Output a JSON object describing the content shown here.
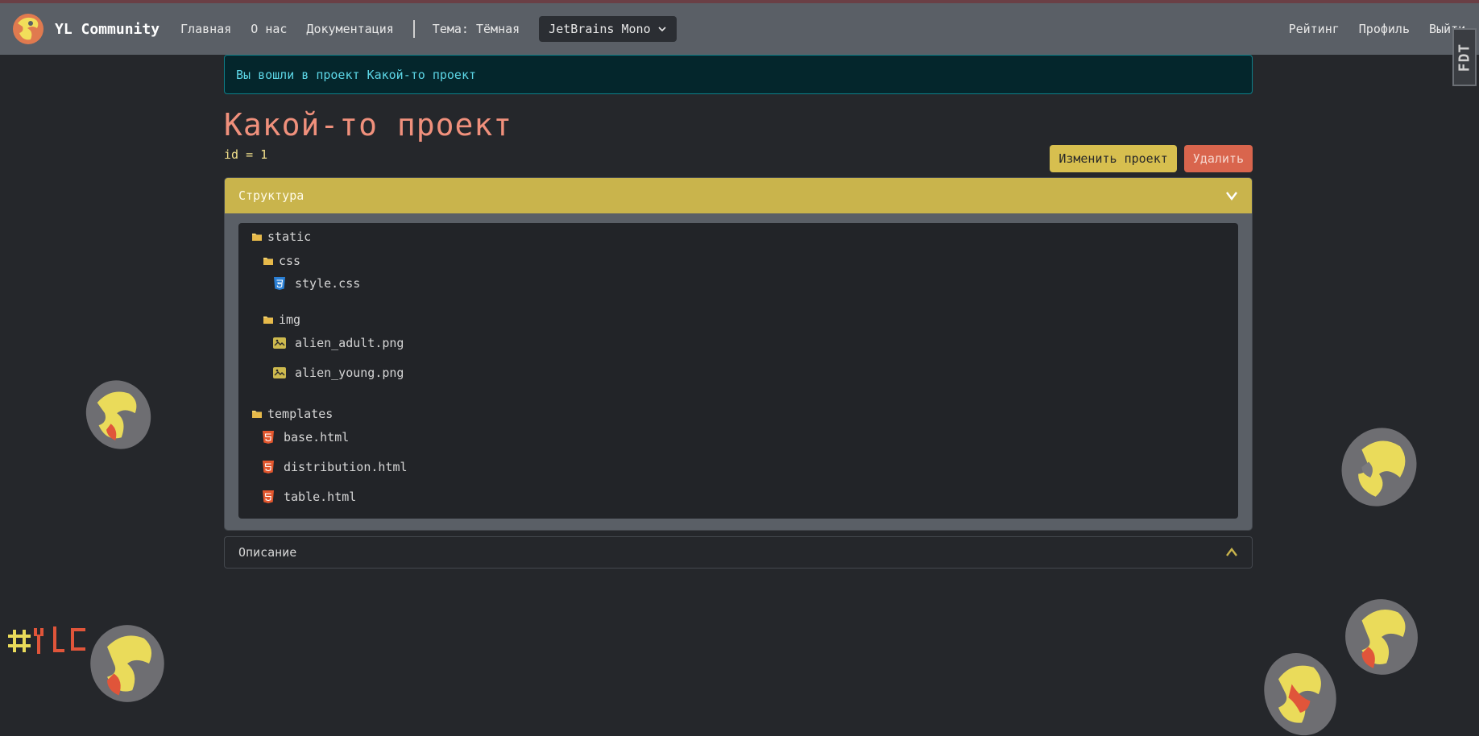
{
  "navbar": {
    "brand": "YL Community",
    "links": [
      "Главная",
      "О нас",
      "Документация"
    ],
    "theme": "Тема: Тёмная",
    "font": "JetBrains Mono",
    "right": [
      "Рейтинг",
      "Профиль",
      "Выйти"
    ]
  },
  "side_badge": "FDT",
  "alert": "Вы вошли в проект Какой-то проект",
  "project": {
    "title": "Какой-то проект",
    "id_text": "id = 1",
    "edit_label": "Изменить проект",
    "delete_label": "Удалить"
  },
  "accordion": {
    "structure_label": "Структура",
    "description_label": "Описание"
  },
  "tree": {
    "static": "static",
    "css": "css",
    "style_css": "style.css",
    "img": "img",
    "alien_adult": "alien_adult.png",
    "alien_young": "alien_young.png",
    "templates": "templates",
    "base_html": "base.html",
    "distribution_html": "distribution.html",
    "table_html": "table.html"
  },
  "colors": {
    "accent_yellow": "#c9b44c",
    "title": "#f0907c",
    "alert_text": "#5cd6e6",
    "delete": "#d9654d"
  }
}
